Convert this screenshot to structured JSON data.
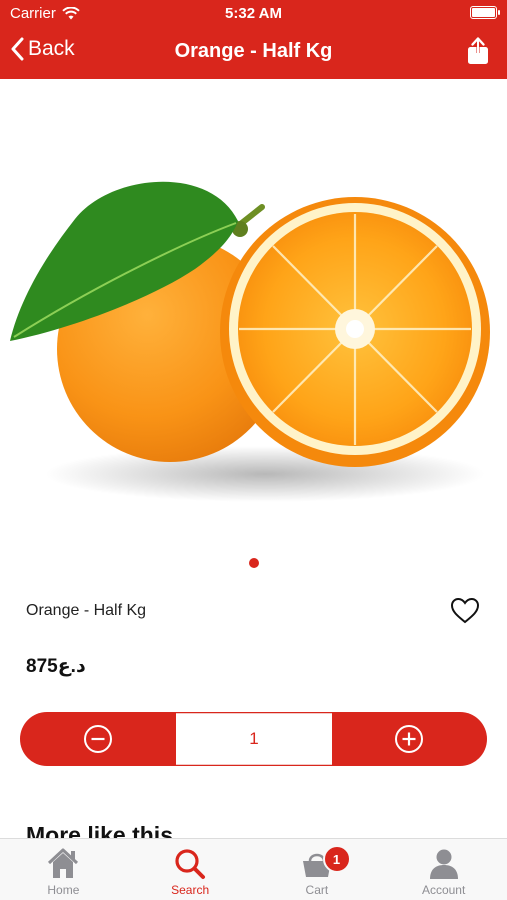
{
  "status_bar": {
    "carrier": "Carrier",
    "time": "5:32 AM"
  },
  "nav": {
    "back_label": "Back",
    "title": "Orange - Half Kg"
  },
  "product": {
    "name": "Orange - Half Kg",
    "price": "875د.ع",
    "quantity": "1",
    "image_page_count": 1,
    "image_page_active": 1
  },
  "section": {
    "more_like_this": "More like this"
  },
  "tabs": [
    {
      "label": "Home",
      "icon": "home-icon",
      "active": false
    },
    {
      "label": "Search",
      "icon": "search-icon",
      "active": true
    },
    {
      "label": "Cart",
      "icon": "cart-icon",
      "active": false,
      "badge": "1"
    },
    {
      "label": "Account",
      "icon": "account-icon",
      "active": false
    }
  ],
  "colors": {
    "brand": "#d9261c",
    "tab_inactive": "#8e8e93"
  }
}
